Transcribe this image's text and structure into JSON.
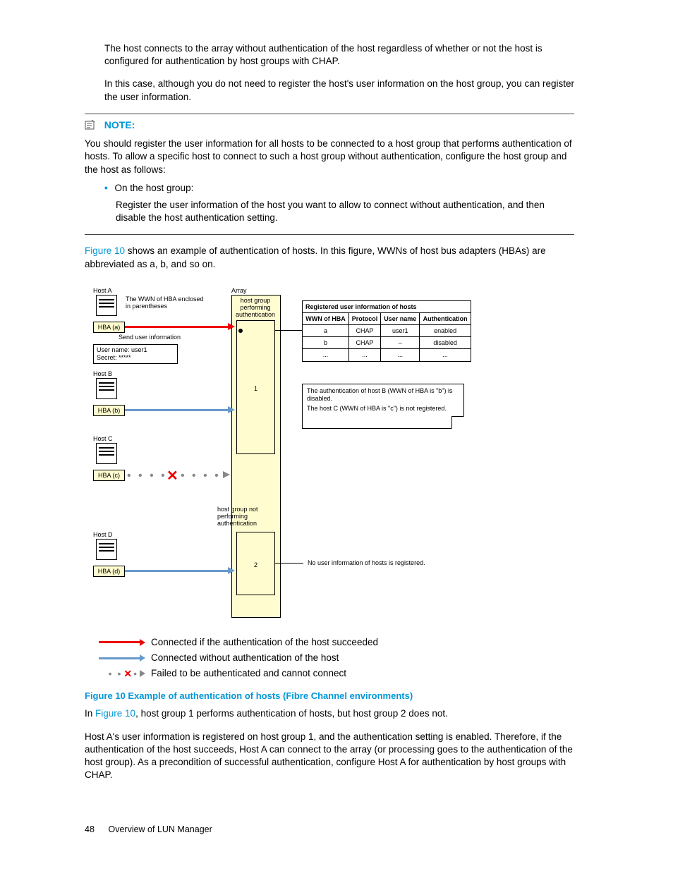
{
  "intro": {
    "p1": "The host connects to the array without authentication of the host regardless of whether or not the host is configured for authentication by host groups with CHAP.",
    "p2": "In this case, although you do not need to register the host's user information on the host group, you can register the user information."
  },
  "note": {
    "label": "NOTE:",
    "body": "You should register the user information for all hosts to be connected to a host group that performs authentication of hosts. To allow a specific host to connect to such a host group without authentication, configure the host group and the host as follows:",
    "bullet": "On the host group:",
    "bullet_body": "Register the user information of the host you want to allow to connect without authentication, and then disable the host authentication setting."
  },
  "after_note": {
    "link": "Figure 10",
    "rest": " shows an example of authentication of hosts. In this figure, WWNs of host bus adapters (HBAs) are abbreviated as a, b, and so on."
  },
  "figure": {
    "hostA": "Host A",
    "hostB": "Host B",
    "hostC": "Host C",
    "hostD": "Host D",
    "array": "Array",
    "wwn_note": "The WWN of HBA enclosed in parentheses",
    "send_info": "Send user information",
    "user_name": "User name: user1",
    "secret": "Secret: *****",
    "hba_a": "HBA (a)",
    "hba_b": "HBA (b)",
    "hba_c": "HBA (c)",
    "hba_d": "HBA (d)",
    "hg_perf": "host group performing authentication",
    "hg_not": "host group not performing authentication",
    "hg1": "1",
    "hg2": "2",
    "reg_title": "Registered user information of hosts",
    "col1": "WWN of HBA",
    "col2": "Protocol",
    "col3": "User name",
    "col4": "Authentication",
    "rowa": {
      "w": "a",
      "p": "CHAP",
      "u": "user1",
      "a": "enabled"
    },
    "rowb": {
      "w": "b",
      "p": "CHAP",
      "u": "–",
      "a": "disabled"
    },
    "rowc": {
      "w": "...",
      "p": "...",
      "u": "...",
      "a": "..."
    },
    "note1": "The authentication of host B (WWN of HBA is \"b\") is disabled.",
    "note2": "The host C (WWN of HBA is \"c\") is not registered.",
    "no_user": "No user information of hosts is registered.",
    "legend1": "Connected if the authentication of the host succeeded",
    "legend2": "Connected without authentication of the host",
    "legend3": "Failed to be authenticated and cannot connect"
  },
  "caption": "Figure 10 Example of authentication of hosts (Fibre Channel environments)",
  "body2": {
    "p1a": "In ",
    "p1link": "Figure 10",
    "p1b": ", host group 1 performs authentication of hosts, but host group 2 does not.",
    "p2": "Host A's user information is registered on host group 1, and the authentication setting is enabled. Therefore, if the authentication of the host succeeds, Host A can connect to the array (or processing goes to the authentication of the host group). As a precondition of successful authentication, configure Host A for authentication by host groups with CHAP."
  },
  "footer": {
    "page": "48",
    "title": "Overview of LUN Manager"
  }
}
